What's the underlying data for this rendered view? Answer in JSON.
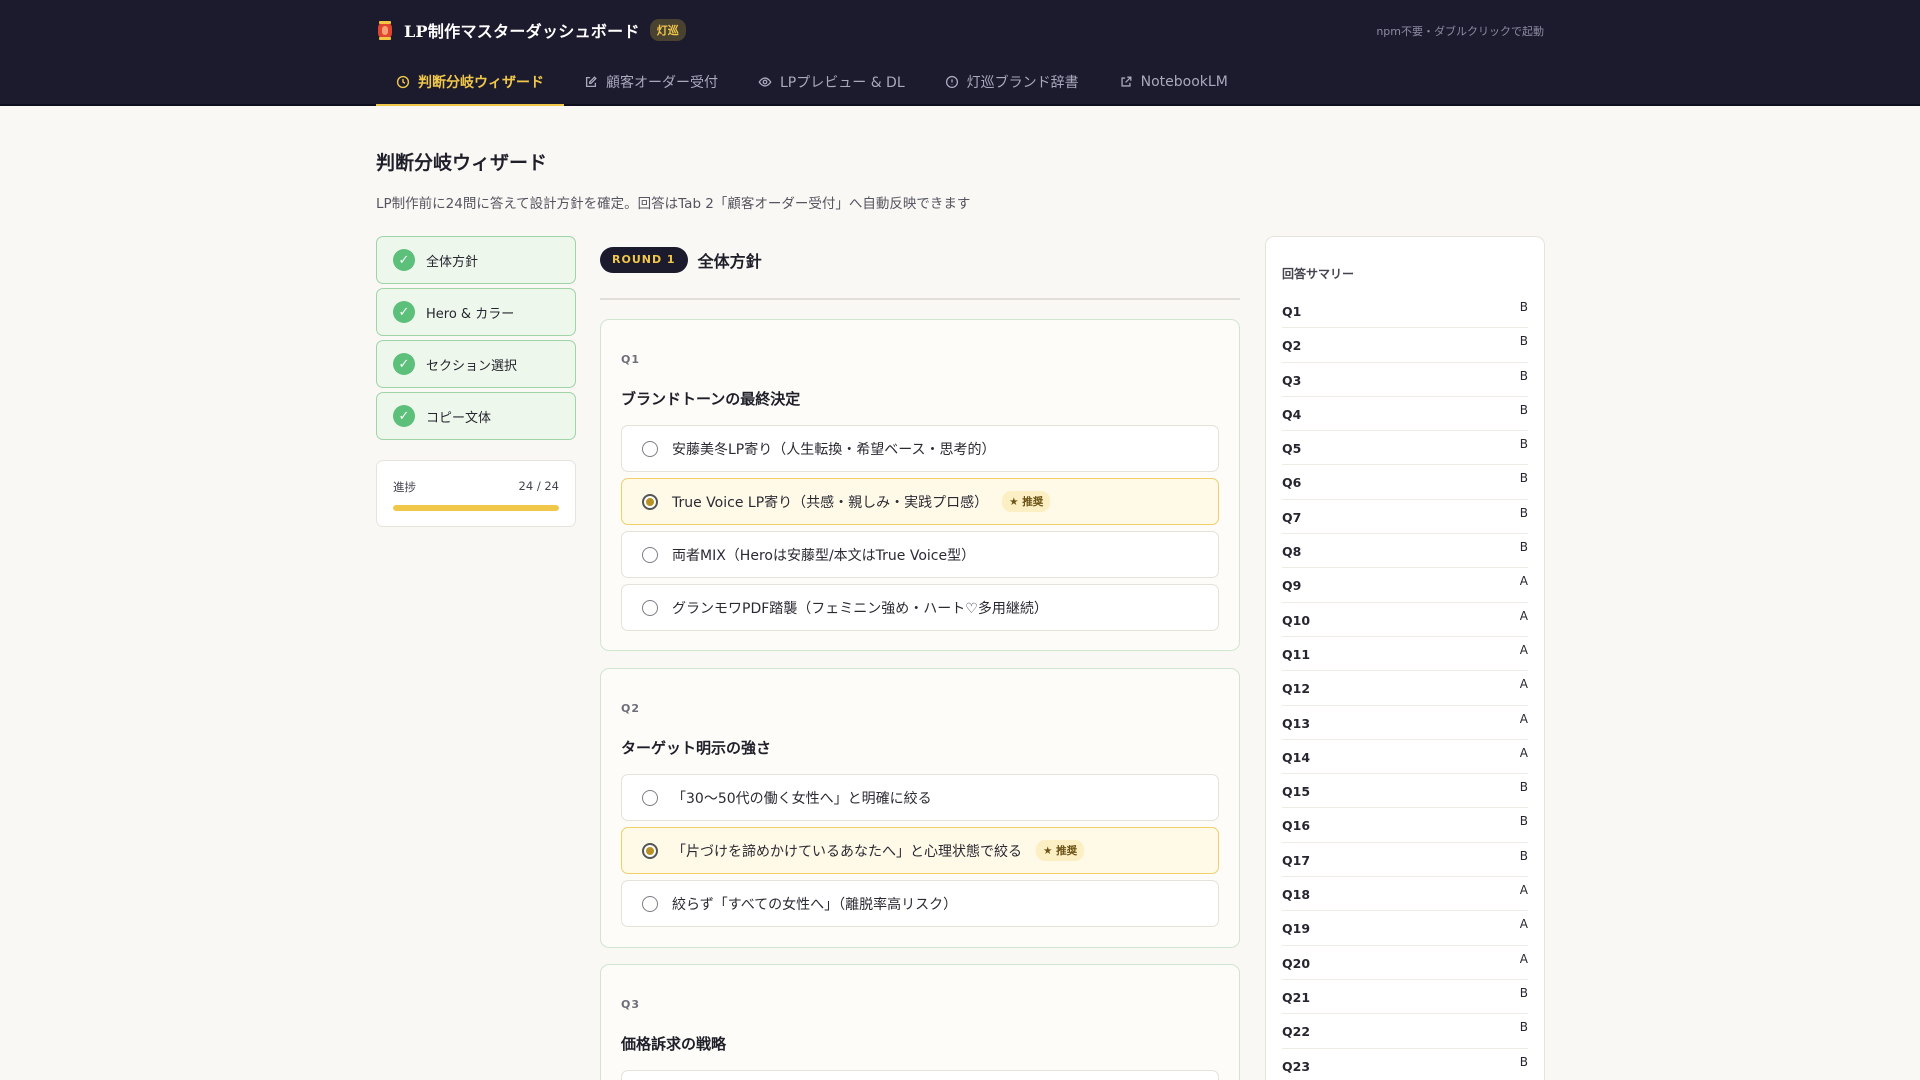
{
  "header": {
    "app_title": "LP制作マスターダッシュボード",
    "badge": "灯巡",
    "note": "npm不要・ダブルクリックで起動",
    "tabs": [
      {
        "label": "判断分岐ウィザード",
        "icon": "clock-icon",
        "active": true
      },
      {
        "label": "顧客オーダー受付",
        "icon": "edit-icon",
        "active": false
      },
      {
        "label": "LPプレビュー & DL",
        "icon": "eye-icon",
        "active": false
      },
      {
        "label": "灯巡ブランド辞書",
        "icon": "info-icon",
        "active": false
      },
      {
        "label": "NotebookLM",
        "icon": "external-link-icon",
        "active": false
      }
    ]
  },
  "page": {
    "title": "判断分岐ウィザード",
    "description": "LP制作前に24問に答えて設計方針を確定。回答はTab 2「顧客オーダー受付」へ自動反映できます"
  },
  "rounds": [
    {
      "label": "全体方針",
      "done": true
    },
    {
      "label": "Hero & カラー",
      "done": true
    },
    {
      "label": "セクション選択",
      "done": true
    },
    {
      "label": "コピー文体",
      "done": true
    }
  ],
  "progress": {
    "label": "進捗",
    "text": "24 / 24",
    "value": 24,
    "total": 24
  },
  "main": {
    "round_pill": "ROUND 1",
    "round_title": "全体方針",
    "recommend_label": "★ 推奨",
    "questions": [
      {
        "num": "Q1",
        "title": "ブランドトーンの最終決定",
        "options": [
          {
            "label": "安藤美冬LP寄り（人生転換・希望ベース・思考的）",
            "selected": false,
            "recommended": false
          },
          {
            "label": "True Voice LP寄り（共感・親しみ・実践プロ感）",
            "selected": true,
            "recommended": true
          },
          {
            "label": "両者MIX（Heroは安藤型/本文はTrue Voice型）",
            "selected": false,
            "recommended": false
          },
          {
            "label": "グランモワPDF踏襲（フェミニン強め・ハート♡多用継続）",
            "selected": false,
            "recommended": false
          }
        ]
      },
      {
        "num": "Q2",
        "title": "ターゲット明示の強さ",
        "options": [
          {
            "label": "「30〜50代の働く女性へ」と明確に絞る",
            "selected": false,
            "recommended": false
          },
          {
            "label": "「片づけを諦めかけているあなたへ」と心理状態で絞る",
            "selected": true,
            "recommended": true
          },
          {
            "label": "絞らず「すべての女性へ」（離脱率高リスク）",
            "selected": false,
            "recommended": false
          }
        ]
      },
      {
        "num": "Q3",
        "title": "価格訴求の戦略",
        "options": []
      }
    ]
  },
  "summary": {
    "title": "回答サマリー",
    "rows": [
      {
        "q": "Q1",
        "a": "B"
      },
      {
        "q": "Q2",
        "a": "B"
      },
      {
        "q": "Q3",
        "a": "B"
      },
      {
        "q": "Q4",
        "a": "B"
      },
      {
        "q": "Q5",
        "a": "B"
      },
      {
        "q": "Q6",
        "a": "B"
      },
      {
        "q": "Q7",
        "a": "B"
      },
      {
        "q": "Q8",
        "a": "B"
      },
      {
        "q": "Q9",
        "a": "A"
      },
      {
        "q": "Q10",
        "a": "A"
      },
      {
        "q": "Q11",
        "a": "A"
      },
      {
        "q": "Q12",
        "a": "A"
      },
      {
        "q": "Q13",
        "a": "A"
      },
      {
        "q": "Q14",
        "a": "A"
      },
      {
        "q": "Q15",
        "a": "B"
      },
      {
        "q": "Q16",
        "a": "B"
      },
      {
        "q": "Q17",
        "a": "B"
      },
      {
        "q": "Q18",
        "a": "A"
      },
      {
        "q": "Q19",
        "a": "A"
      },
      {
        "q": "Q20",
        "a": "A"
      },
      {
        "q": "Q21",
        "a": "B"
      },
      {
        "q": "Q22",
        "a": "B"
      },
      {
        "q": "Q23",
        "a": "B"
      }
    ]
  },
  "colors": {
    "nav_bg": "#1c1b2e",
    "accent": "#f1c74a",
    "done_green": "#5cc07a",
    "page_bg": "#faf8f4"
  }
}
